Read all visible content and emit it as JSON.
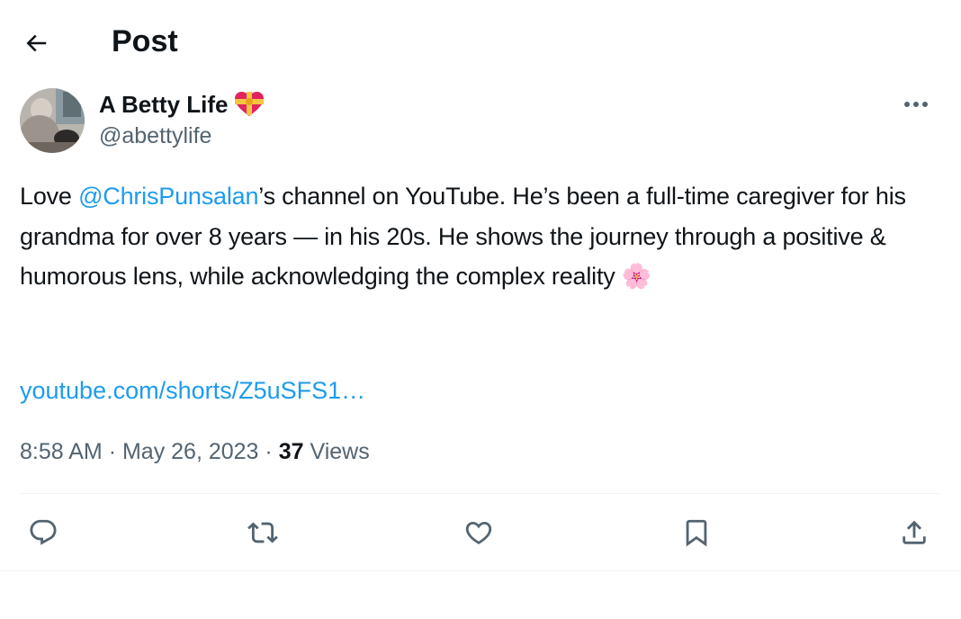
{
  "header": {
    "title": "Post",
    "back_icon": "arrow-left-icon"
  },
  "author": {
    "display_name": "A Betty Life",
    "badge_emoji": "heart-with-ribbon-emoji",
    "handle": "@abettylife"
  },
  "tweet": {
    "text_before_mention": "Love ",
    "mention": "@ChrisPunsalan",
    "text_after_mention": "’s channel on YouTube. He’s been a full-time caregiver for his grandma for over 8 years — in his 20s. He shows the journey through a positive & humorous lens, while acknowledging the complex reality ",
    "emoji": "🌸",
    "link": "youtube.com/shorts/Z5uSFS1…"
  },
  "meta": {
    "time": "8:58 AM",
    "separator": "·",
    "date": "May 26, 2023",
    "views_count": "37",
    "views_label": "Views"
  },
  "actions": [
    {
      "name": "reply",
      "icon": "reply-icon"
    },
    {
      "name": "repost",
      "icon": "repost-icon"
    },
    {
      "name": "like",
      "icon": "heart-icon"
    },
    {
      "name": "bookmark",
      "icon": "bookmark-icon"
    },
    {
      "name": "share",
      "icon": "share-icon"
    }
  ],
  "colors": {
    "accent": "#1d9bf0",
    "text_primary": "#0f1419",
    "text_secondary": "#536471",
    "divider": "#eff3f4"
  }
}
